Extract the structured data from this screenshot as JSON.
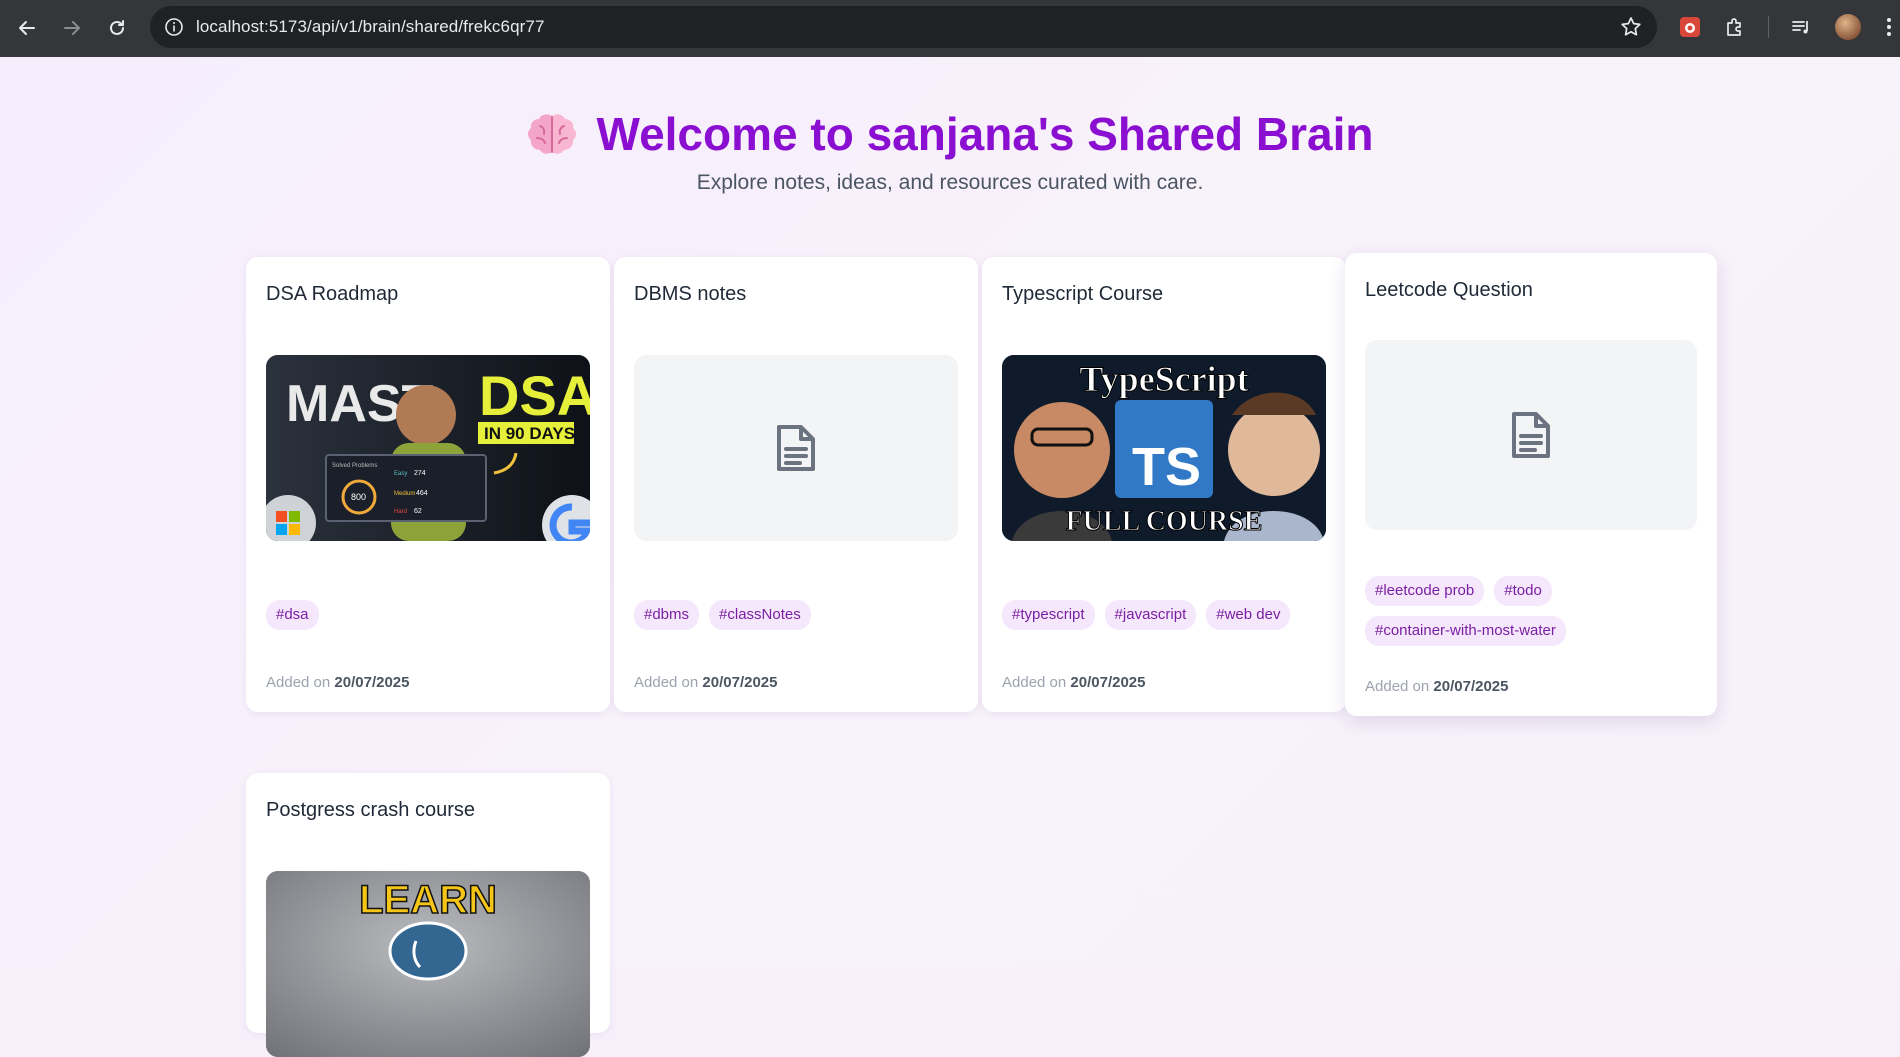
{
  "browser": {
    "url": "localhost:5173/api/v1/brain/shared/frekc6qr77"
  },
  "hero": {
    "title": "Welcome to sanjana's Shared Brain",
    "subtitle": "Explore notes, ideas, and resources curated with care."
  },
  "cards": [
    {
      "title": "DSA Roadmap",
      "thumb": "video",
      "thumb_text": [
        "MAST",
        "DSA",
        "IN 90 DAYS",
        "800",
        "Solved Problems",
        "Easy",
        "Medium",
        "Hard",
        "274",
        "464",
        "62"
      ],
      "tags": [
        "#dsa"
      ],
      "added_label": "Added on",
      "date": "20/07/2025"
    },
    {
      "title": "DBMS notes",
      "thumb": "document",
      "tags": [
        "#dbms",
        "#classNotes"
      ],
      "added_label": "Added on",
      "date": "20/07/2025"
    },
    {
      "title": "Typescript Course",
      "thumb": "video",
      "thumb_text": [
        "TypeScript",
        "TS",
        "FULL COURSE"
      ],
      "tags": [
        "#typescript",
        "#javascript",
        "#web dev"
      ],
      "added_label": "Added on",
      "date": "20/07/2025"
    },
    {
      "title": "Leetcode Question",
      "thumb": "document",
      "tags": [
        "#leetcode prob",
        "#todo",
        "#container-with-most-water"
      ],
      "added_label": "Added on",
      "date": "20/07/2025"
    },
    {
      "title": "Postgress crash course",
      "thumb": "video",
      "thumb_text": [
        "LEARN"
      ]
    }
  ],
  "colors": {
    "accent": "#8a0fd0",
    "tag_bg": "#f5e8fc",
    "tag_text": "#7b1fa2"
  }
}
